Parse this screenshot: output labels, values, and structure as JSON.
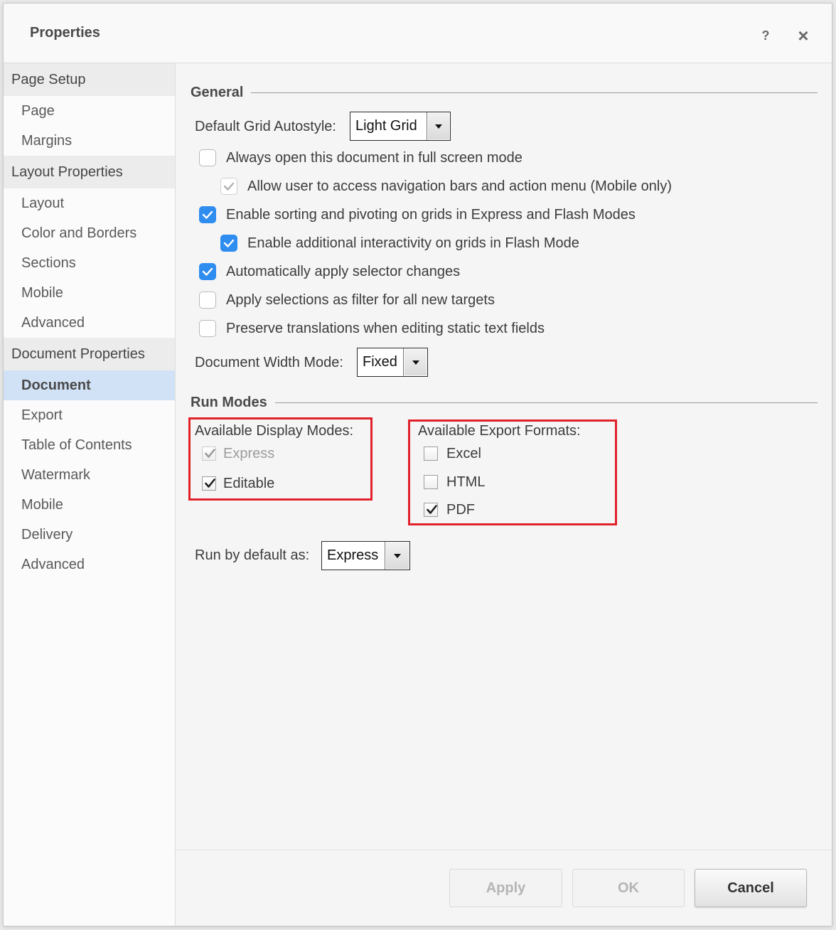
{
  "dialog": {
    "title": "Properties",
    "help_glyph": "?",
    "close_glyph": "×",
    "icons": {
      "help": "help-icon",
      "close": "close-icon",
      "dropdown": "chevron-down-icon",
      "check": "checkmark-icon"
    }
  },
  "colors": {
    "accent": "#2f8df0",
    "selected_nav_bg": "#d2e2f6",
    "section_header_bg": "#ececec",
    "highlight_box": "#e1222b",
    "text": "#3c3c3c"
  },
  "sidebar": {
    "sections": [
      {
        "label": "Page Setup",
        "items": [
          {
            "label": "Page",
            "selected": false
          },
          {
            "label": "Margins",
            "selected": false
          }
        ]
      },
      {
        "label": "Layout Properties",
        "items": [
          {
            "label": "Layout",
            "selected": false
          },
          {
            "label": "Color and Borders",
            "selected": false
          },
          {
            "label": "Sections",
            "selected": false
          },
          {
            "label": "Mobile",
            "selected": false
          },
          {
            "label": "Advanced",
            "selected": false
          }
        ]
      },
      {
        "label": "Document Properties",
        "items": [
          {
            "label": "Document",
            "selected": true
          },
          {
            "label": "Export",
            "selected": false
          },
          {
            "label": "Table of Contents",
            "selected": false
          },
          {
            "label": "Watermark",
            "selected": false
          },
          {
            "label": "Mobile",
            "selected": false
          },
          {
            "label": "Delivery",
            "selected": false
          },
          {
            "label": "Advanced",
            "selected": false
          }
        ]
      }
    ]
  },
  "general": {
    "heading": "General",
    "grid_autostyle": {
      "label": "Default Grid Autostyle:",
      "value": "Light Grid"
    },
    "options": [
      {
        "label": "Always open this document in full screen mode",
        "checked": false,
        "disabled": false
      },
      {
        "label": "Allow user to access navigation bars and action menu (Mobile only)",
        "checked": true,
        "disabled": true
      },
      {
        "label": "Enable sorting and pivoting on grids in Express and Flash Modes",
        "checked": true,
        "disabled": false
      },
      {
        "label": "Enable additional interactivity on grids in Flash Mode",
        "checked": true,
        "disabled": false
      },
      {
        "label": "Automatically apply selector changes",
        "checked": true,
        "disabled": false
      },
      {
        "label": "Apply selections as filter for all new targets",
        "checked": false,
        "disabled": false
      },
      {
        "label": "Preserve translations when editing static text fields",
        "checked": false,
        "disabled": false
      }
    ],
    "width_mode": {
      "label": "Document Width Mode:",
      "value": "Fixed"
    }
  },
  "run_modes": {
    "heading": "Run Modes",
    "display_modes": {
      "label": "Available Display Modes:",
      "options": [
        {
          "label": "Express",
          "checked": true,
          "disabled": true
        },
        {
          "label": "Editable",
          "checked": true,
          "disabled": false
        }
      ]
    },
    "export_formats": {
      "label": "Available Export Formats:",
      "options": [
        {
          "label": "Excel",
          "checked": false,
          "disabled": false
        },
        {
          "label": "HTML",
          "checked": false,
          "disabled": false
        },
        {
          "label": "PDF",
          "checked": true,
          "disabled": false
        }
      ]
    },
    "run_default": {
      "label": "Run by default as:",
      "value": "Express"
    }
  },
  "footer": {
    "apply": {
      "label": "Apply",
      "disabled": true
    },
    "ok": {
      "label": "OK",
      "disabled": true
    },
    "cancel": {
      "label": "Cancel",
      "disabled": false
    }
  }
}
